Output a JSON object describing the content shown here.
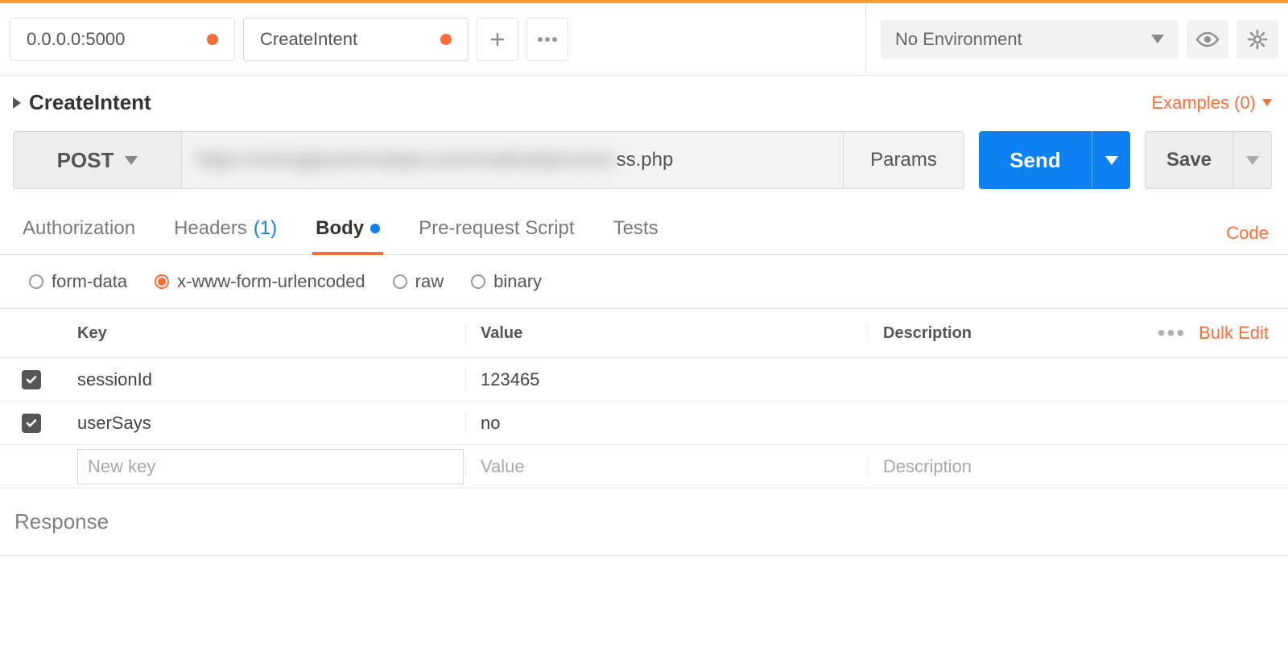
{
  "tabs": [
    {
      "label": "0.0.0.0:5000",
      "modified": true
    },
    {
      "label": "CreateIntent",
      "modified": true
    }
  ],
  "env": {
    "selected": "No Environment"
  },
  "request": {
    "title": "CreateIntent",
    "examples_label": "Examples (0)",
    "method": "POST",
    "url_blur": "https://miningbusinessdata.com/chatfuel/process",
    "url_tail": "ss.php",
    "params_label": "Params",
    "send_label": "Send",
    "save_label": "Save"
  },
  "section_tabs": {
    "authorization": "Authorization",
    "headers": "Headers",
    "headers_count": "(1)",
    "body": "Body",
    "prerequest": "Pre-request Script",
    "tests": "Tests",
    "code": "Code"
  },
  "body_types": {
    "form_data": "form-data",
    "urlencoded": "x-www-form-urlencoded",
    "raw": "raw",
    "binary": "binary"
  },
  "kv": {
    "head": {
      "key": "Key",
      "value": "Value",
      "description": "Description",
      "bulk": "Bulk Edit"
    },
    "rows": [
      {
        "key": "sessionId",
        "value": "123465",
        "description": ""
      },
      {
        "key": "userSays",
        "value": "no",
        "description": ""
      }
    ],
    "placeholders": {
      "key": "New key",
      "value": "Value",
      "description": "Description"
    }
  },
  "response_label": "Response"
}
